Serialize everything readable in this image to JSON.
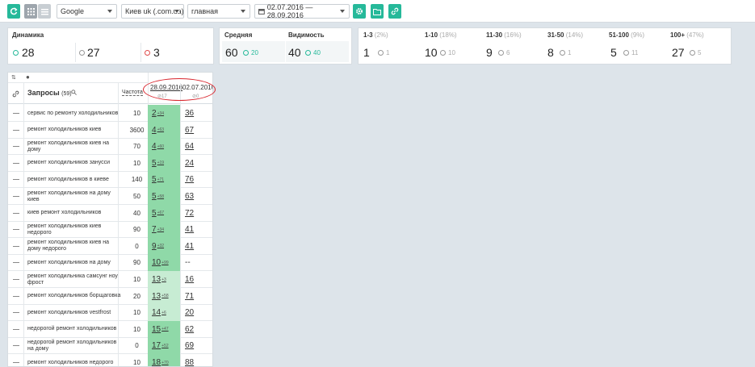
{
  "toolbar": {
    "engine": "Google",
    "region": "Киев uk (.com.ua)",
    "page": "главная",
    "date_range": "02.07.2016 — 28.09.2016"
  },
  "dynamics": {
    "title": "Динамика",
    "up": "28",
    "same": "27",
    "down": "3"
  },
  "average": {
    "title": "Средняя",
    "value": "60",
    "delta": "20"
  },
  "visibility": {
    "title": "Видимость",
    "value": "40",
    "delta": "40"
  },
  "ranges": [
    {
      "label": "1-3",
      "pct": "(2%)",
      "value": "1",
      "delta": "1"
    },
    {
      "label": "1-10",
      "pct": "(18%)",
      "value": "10",
      "delta": "10"
    },
    {
      "label": "11-30",
      "pct": "(16%)",
      "value": "9",
      "delta": "6"
    },
    {
      "label": "31-50",
      "pct": "(14%)",
      "value": "8",
      "delta": "1"
    },
    {
      "label": "51-100",
      "pct": "(9%)",
      "value": "5",
      "delta": "11"
    },
    {
      "label": "100+",
      "pct": "(47%)",
      "value": "27",
      "delta": "5"
    }
  ],
  "table": {
    "queries_label": "Запросы",
    "queries_count": "(59)",
    "freq_label": "Частота",
    "date1": "28.09.2016",
    "date1_count": "17",
    "date2": "02.07.2016",
    "date2_count": "0",
    "rows": [
      {
        "query": "сервис по ремонту холодильников",
        "freq": "10",
        "pos1": "2",
        "delta": "+34",
        "pos2": "36"
      },
      {
        "query": "ремонт холодильников киев",
        "freq": "3600",
        "pos1": "4",
        "delta": "+63",
        "pos2": "67"
      },
      {
        "query": "ремонт холодильников киев на дому",
        "freq": "70",
        "pos1": "4",
        "delta": "+60",
        "pos2": "64"
      },
      {
        "query": "ремонт холодильников занусси",
        "freq": "10",
        "pos1": "5",
        "delta": "+19",
        "pos2": "24"
      },
      {
        "query": "ремонт холодильников в киеве",
        "freq": "140",
        "pos1": "5",
        "delta": "+71",
        "pos2": "76"
      },
      {
        "query": "ремонт холодильников на дому киев",
        "freq": "50",
        "pos1": "5",
        "delta": "+58",
        "pos2": "63"
      },
      {
        "query": "киев ремонт холодильников",
        "freq": "40",
        "pos1": "5",
        "delta": "+67",
        "pos2": "72"
      },
      {
        "query": "ремонт холодильников киев недорого",
        "freq": "90",
        "pos1": "7",
        "delta": "+34",
        "pos2": "41"
      },
      {
        "query": "ремонт холодильников киев на дому недорого",
        "freq": "0",
        "pos1": "9",
        "delta": "+32",
        "pos2": "41"
      },
      {
        "query": "ремонт холодильников на дому",
        "freq": "90",
        "pos1": "10",
        "delta": "+99",
        "pos2": "--"
      },
      {
        "query": "ремонт холодильника самсунг ноу фрост",
        "freq": "10",
        "pos1": "13",
        "delta": "+3",
        "pos2": "16"
      },
      {
        "query": "ремонт холодильников борщаговка",
        "freq": "20",
        "pos1": "13",
        "delta": "+58",
        "pos2": "71"
      },
      {
        "query": "ремонт холодильников vestfrost",
        "freq": "10",
        "pos1": "14",
        "delta": "+6",
        "pos2": "20"
      },
      {
        "query": "недорогой ремонт холодильников",
        "freq": "10",
        "pos1": "15",
        "delta": "+47",
        "pos2": "62"
      },
      {
        "query": "недорогой ремонт холодильников на дому",
        "freq": "0",
        "pos1": "17",
        "delta": "+52",
        "pos2": "69"
      },
      {
        "query": "ремонт холодильников недорого",
        "freq": "10",
        "pos1": "18",
        "delta": "+70",
        "pos2": "88"
      }
    ]
  }
}
